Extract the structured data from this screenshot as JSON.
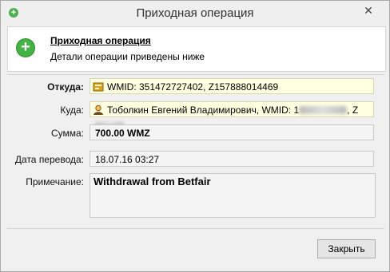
{
  "window": {
    "title": "Приходная операция",
    "close_glyph": "✕"
  },
  "header": {
    "title": "Приходная операция",
    "subtitle": "Детали операции приведены ниже",
    "icon": "plus-circle-icon"
  },
  "form": {
    "from": {
      "label": "Откуда:",
      "value": "WMID: 351472727402, Z157888014469"
    },
    "to": {
      "label": "Куда:",
      "name": "Тоболкин Евгений Владимирович, WMID: 1",
      "mid": ", Z"
    },
    "amount": {
      "label": "Сумма:",
      "value": "700.00 WMZ"
    },
    "date": {
      "label": "Дата перевода:",
      "value": "18.07.16 03:27"
    },
    "note": {
      "label": "Примечание:",
      "value": "Withdrawal from Betfair"
    }
  },
  "footer": {
    "close_button": "Закрыть"
  },
  "colors": {
    "field_highlight": "#ffffe1",
    "icon_green": "#45b245"
  }
}
